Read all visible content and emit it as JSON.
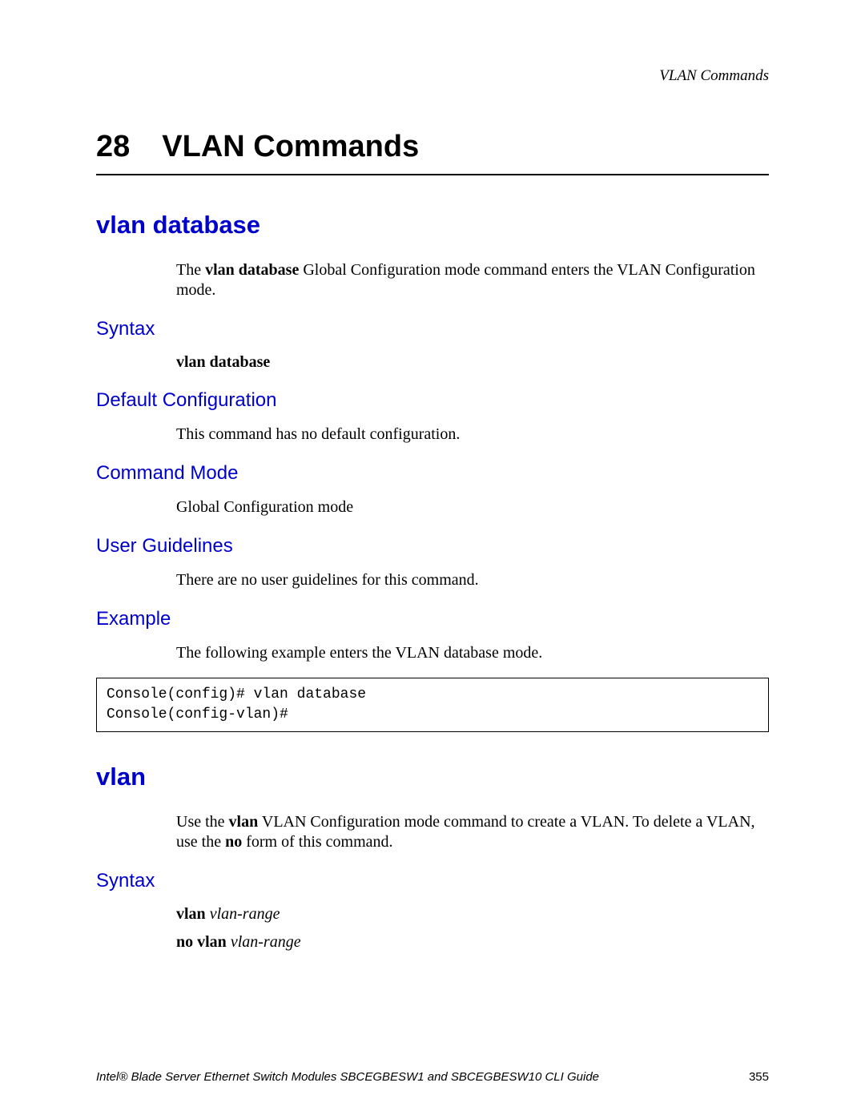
{
  "running_header": "VLAN Commands",
  "chapter": {
    "number": "28",
    "title": "VLAN Commands"
  },
  "section1": {
    "title": "vlan database",
    "intro_pre": "The ",
    "intro_bold": "vlan database",
    "intro_post": " Global Configuration mode command enters the VLAN Configuration mode.",
    "syntax": {
      "heading": "Syntax",
      "line_bold": "vlan database"
    },
    "default_cfg": {
      "heading": "Default Configuration",
      "body": "This command has no default configuration."
    },
    "command_mode": {
      "heading": "Command Mode",
      "body": "Global Configuration mode"
    },
    "user_guidelines": {
      "heading": "User Guidelines",
      "body": "There are no user guidelines for this command."
    },
    "example": {
      "heading": "Example",
      "body": "The following example enters the VLAN database mode.",
      "code": "Console(config)# vlan database\nConsole(config-vlan)#"
    }
  },
  "section2": {
    "title": "vlan",
    "intro_pre": "Use the ",
    "intro_bold1": "vlan",
    "intro_mid1": " VLAN Configuration mode command to create a VLAN. To delete a VLAN, use the ",
    "intro_bold2": "no",
    "intro_post": " form of this command.",
    "syntax": {
      "heading": "Syntax",
      "line1_bold": "vlan",
      "line1_ital": "vlan-range",
      "line2_bold": "no vlan",
      "line2_ital": "vlan-range"
    }
  },
  "footer": {
    "left": "Intel® Blade Server Ethernet Switch Modules SBCEGBESW1 and SBCEGBESW10 CLI Guide",
    "right": "355"
  }
}
